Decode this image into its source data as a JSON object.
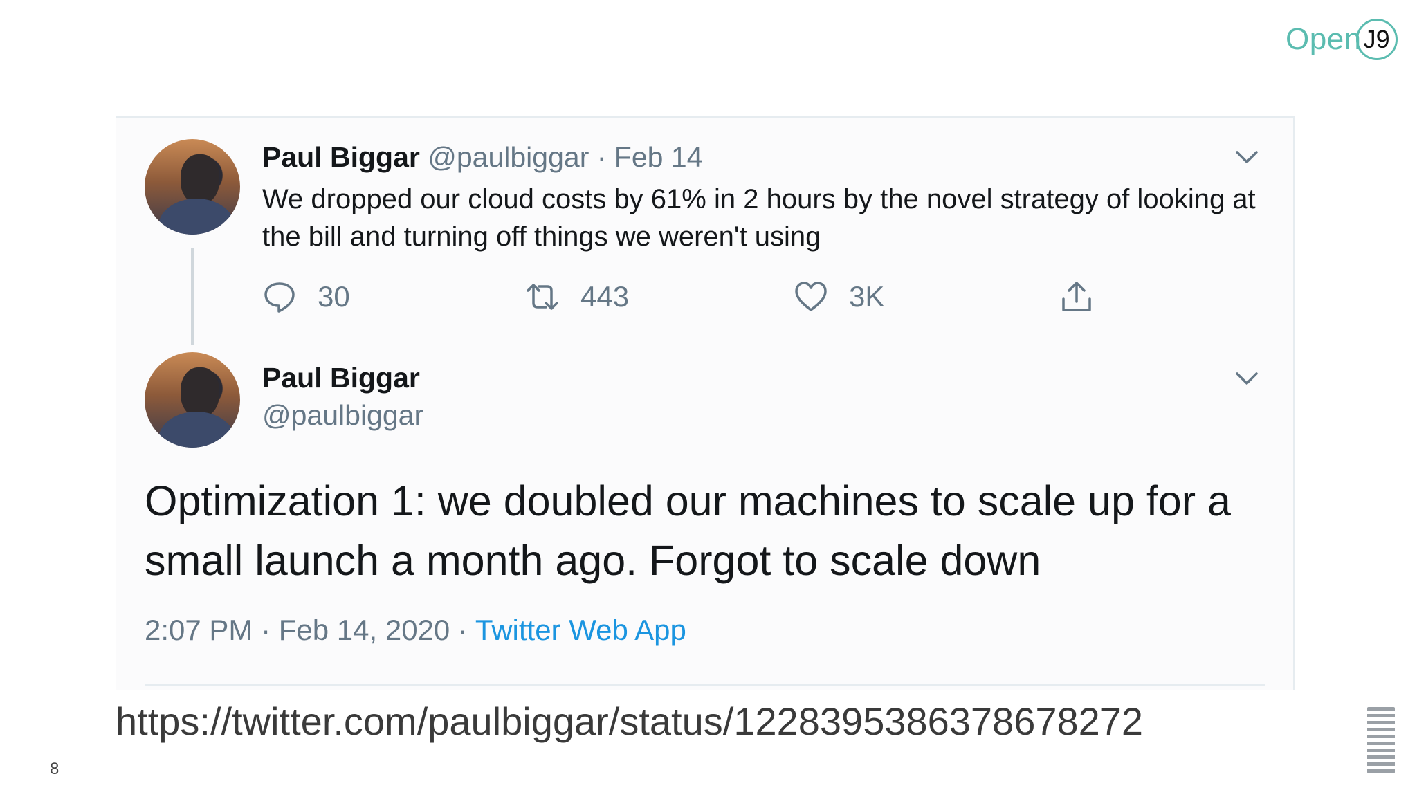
{
  "logo": {
    "open": "Open",
    "j9": "J9"
  },
  "tweet1": {
    "name": "Paul Biggar",
    "handle": "@paulbiggar",
    "separator": " · ",
    "date": "Feb 14",
    "text": "We dropped our cloud costs by 61% in 2 hours by the novel strategy of looking at the bill and turning off things we weren't using",
    "replies": "30",
    "retweets": "443",
    "likes": "3K"
  },
  "tweet2": {
    "name": "Paul Biggar",
    "handle": "@paulbiggar",
    "text": "Optimization 1: we doubled our machines to scale up for a small launch a month ago. Forgot to scale down",
    "time": "2:07 PM",
    "date": "Feb 14, 2020",
    "separator": " · ",
    "source": "Twitter Web App"
  },
  "url": "https://twitter.com/paulbiggar/status/1228395386378678272",
  "page_number": "8",
  "colors": {
    "accent": "#5bbcb0",
    "link": "#1b95e0",
    "muted": "#657786",
    "text": "#14171a"
  }
}
